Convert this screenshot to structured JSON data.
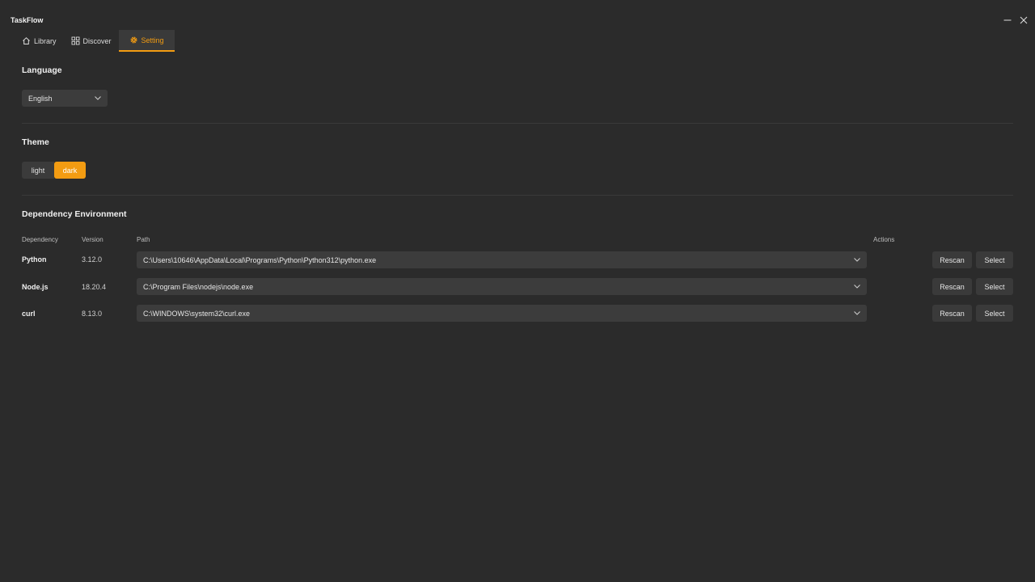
{
  "app": {
    "title": "TaskFlow"
  },
  "tabs": [
    {
      "label": "Library",
      "icon": "home-icon"
    },
    {
      "label": "Discover",
      "icon": "grid-icon"
    },
    {
      "label": "Setting",
      "icon": "gear-icon",
      "active": true
    }
  ],
  "language": {
    "title": "Language",
    "selected": "English"
  },
  "theme": {
    "title": "Theme",
    "options": [
      "light",
      "dark"
    ],
    "selected": "dark"
  },
  "dependencies": {
    "title": "Dependency Environment",
    "columns": [
      "Dependency",
      "Version",
      "Path",
      "Actions"
    ],
    "rows": [
      {
        "name": "Python",
        "version": "3.12.0",
        "path": "C:\\Users\\10646\\AppData\\Local\\Programs\\Python\\Python312\\python.exe"
      },
      {
        "name": "Node.js",
        "version": "18.20.4",
        "path": "C:\\Program Files\\nodejs\\node.exe"
      },
      {
        "name": "curl",
        "version": "8.13.0",
        "path": "C:\\WINDOWS\\system32\\curl.exe"
      }
    ],
    "rescan_label": "Rescan",
    "select_label": "Select"
  },
  "colors": {
    "background": "#2b2b2b",
    "accent": "#f39c12",
    "control": "#3c3c3c"
  }
}
